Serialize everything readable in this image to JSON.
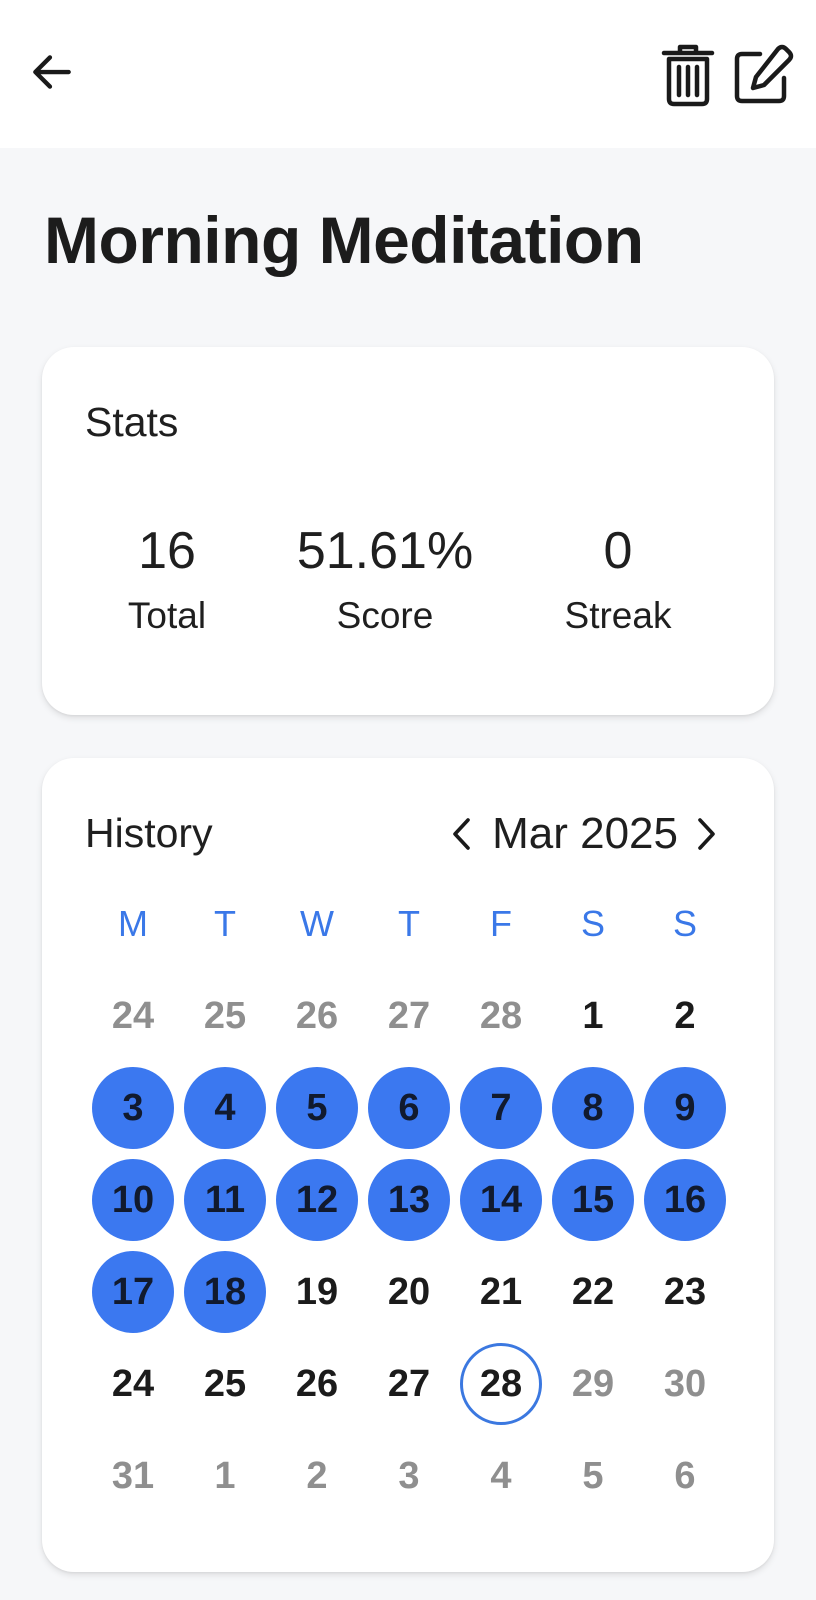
{
  "header": {
    "back_icon": "arrow-left-icon",
    "delete_icon": "trash-icon",
    "edit_icon": "edit-icon"
  },
  "habit": {
    "title": "Morning Meditation"
  },
  "stats": {
    "title": "Stats",
    "items": [
      {
        "value": "16",
        "label": "Total"
      },
      {
        "value": "51.61%",
        "label": "Score"
      },
      {
        "value": "0",
        "label": "Streak"
      }
    ]
  },
  "history": {
    "title": "History",
    "month": "Mar 2025",
    "weekdays": [
      "M",
      "T",
      "W",
      "T",
      "F",
      "S",
      "S"
    ],
    "weeks": [
      [
        {
          "d": "24",
          "s": "muted"
        },
        {
          "d": "25",
          "s": "muted"
        },
        {
          "d": "26",
          "s": "muted"
        },
        {
          "d": "27",
          "s": "muted"
        },
        {
          "d": "28",
          "s": "muted"
        },
        {
          "d": "1",
          "s": "normal"
        },
        {
          "d": "2",
          "s": "normal"
        }
      ],
      [
        {
          "d": "3",
          "s": "done"
        },
        {
          "d": "4",
          "s": "done"
        },
        {
          "d": "5",
          "s": "done"
        },
        {
          "d": "6",
          "s": "done"
        },
        {
          "d": "7",
          "s": "done"
        },
        {
          "d": "8",
          "s": "done"
        },
        {
          "d": "9",
          "s": "done"
        }
      ],
      [
        {
          "d": "10",
          "s": "done"
        },
        {
          "d": "11",
          "s": "done"
        },
        {
          "d": "12",
          "s": "done"
        },
        {
          "d": "13",
          "s": "done"
        },
        {
          "d": "14",
          "s": "done"
        },
        {
          "d": "15",
          "s": "done"
        },
        {
          "d": "16",
          "s": "done"
        }
      ],
      [
        {
          "d": "17",
          "s": "done"
        },
        {
          "d": "18",
          "s": "done"
        },
        {
          "d": "19",
          "s": "normal"
        },
        {
          "d": "20",
          "s": "normal"
        },
        {
          "d": "21",
          "s": "normal"
        },
        {
          "d": "22",
          "s": "normal"
        },
        {
          "d": "23",
          "s": "normal"
        }
      ],
      [
        {
          "d": "24",
          "s": "normal"
        },
        {
          "d": "25",
          "s": "normal"
        },
        {
          "d": "26",
          "s": "normal"
        },
        {
          "d": "27",
          "s": "normal"
        },
        {
          "d": "28",
          "s": "today"
        },
        {
          "d": "29",
          "s": "muted"
        },
        {
          "d": "30",
          "s": "muted"
        }
      ],
      [
        {
          "d": "31",
          "s": "muted"
        },
        {
          "d": "1",
          "s": "muted"
        },
        {
          "d": "2",
          "s": "muted"
        },
        {
          "d": "3",
          "s": "muted"
        },
        {
          "d": "4",
          "s": "muted"
        },
        {
          "d": "5",
          "s": "muted"
        },
        {
          "d": "6",
          "s": "muted"
        }
      ]
    ]
  },
  "colors": {
    "accent": "#3b78f0",
    "weekday": "#3a78e8",
    "muted_text": "#8f8f8f",
    "background": "#f6f7f9",
    "card": "#ffffff"
  }
}
